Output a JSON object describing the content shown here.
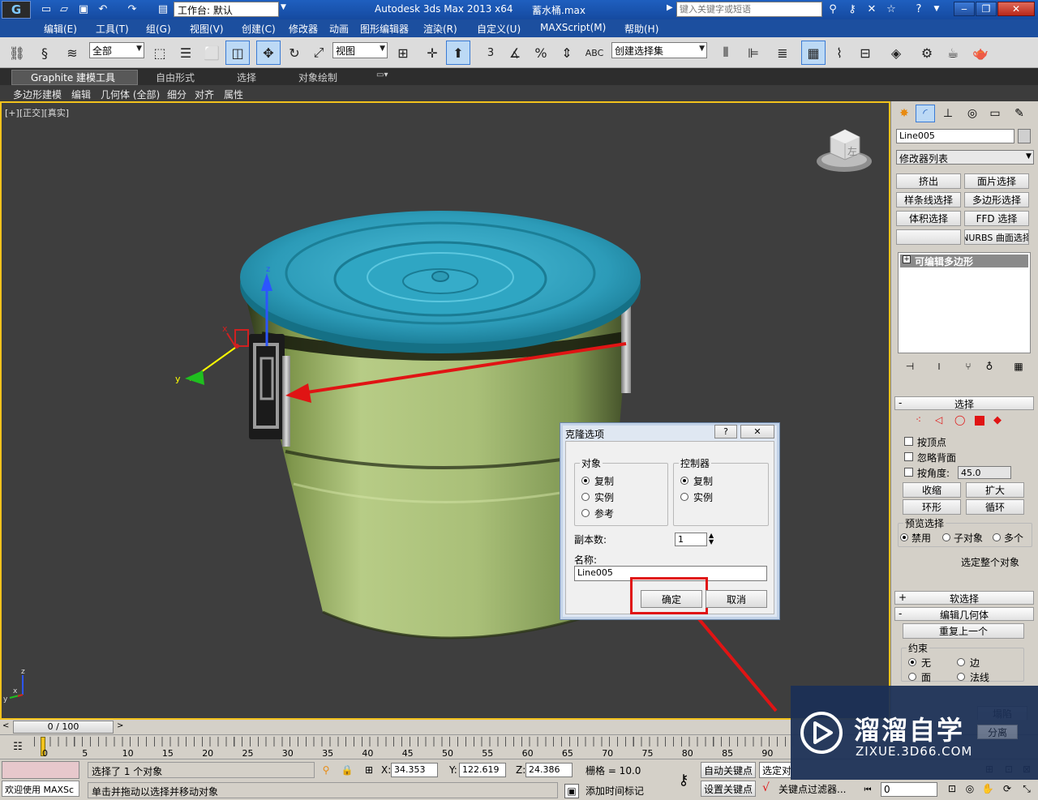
{
  "titlebar": {
    "workspace_label": "工作台: 默认",
    "app_title": "Autodesk 3ds Max  2013 x64",
    "file_name": "蓄水桶.max",
    "search_placeholder": "键入关键字或短语"
  },
  "menubar": {
    "items": [
      "编辑(E)",
      "工具(T)",
      "组(G)",
      "视图(V)",
      "创建(C)",
      "修改器",
      "动画",
      "图形编辑器",
      "渲染(R)",
      "自定义(U)",
      "MAXScript(M)",
      "帮助(H)"
    ]
  },
  "toolbar": {
    "selection_filter": "全部",
    "ref_coord": "视图",
    "named_selection": "创建选择集",
    "snap_label": "3",
    "percent_label": "%"
  },
  "ribbon": {
    "tabs": [
      "Graphite 建模工具",
      "自由形式",
      "选择",
      "对象绘制"
    ],
    "subtabs": [
      "多边形建模",
      "编辑",
      "几何体 (全部)",
      "细分",
      "对齐",
      "属性"
    ]
  },
  "viewport": {
    "label_plus": "[+]",
    "label_view": "[正交]",
    "label_shading": "[真实]",
    "viewcube_text": "左",
    "gizmo_axes": [
      "z",
      "y",
      "x"
    ],
    "corner_axes": [
      "z",
      "x",
      "y"
    ]
  },
  "command_panel": {
    "object_name": "Line005",
    "modifier_list": "修改器列表",
    "modifier_buttons": [
      "挤出",
      "面片选择",
      "样条线选择",
      "多边形选择",
      "体积选择",
      "FFD 选择",
      "",
      "NURBS 曲面选择"
    ],
    "stack_item": "可编辑多边形",
    "selection_rollout": {
      "title": "选择",
      "by_vertex": "按顶点",
      "ignore_backfacing": "忽略背面",
      "by_angle": "按角度:",
      "angle_value": "45.0",
      "shrink": "收缩",
      "grow": "扩大",
      "ring": "环形",
      "loop": "循环",
      "preview_title": "预览选择",
      "preview_disable": "禁用",
      "preview_subobject": "子对象",
      "preview_multi": "多个",
      "select_whole": "选定整个对象"
    },
    "soft_selection": "软选择",
    "edit_geometry": "编辑几何体",
    "repeat_last": "重复上一个",
    "constraints": {
      "title": "约束",
      "none": "无",
      "edge": "边",
      "face": "面",
      "normal": "法线"
    },
    "partial_buttons": [
      "塌陷",
      "分离"
    ]
  },
  "dialog": {
    "title": "克隆选项",
    "help_button": "?",
    "close_button": "✕",
    "object_group": "对象",
    "object_options": [
      "复制",
      "实例",
      "参考"
    ],
    "object_selected": 0,
    "controller_group": "控制器",
    "controller_options": [
      "复制",
      "实例"
    ],
    "controller_selected": 0,
    "copies_label": "副本数:",
    "copies_value": "1",
    "name_label": "名称:",
    "name_value": "Line005",
    "ok_button": "确定",
    "cancel_button": "取消"
  },
  "timeline": {
    "frame_label": "0 / 100",
    "ticks": [
      "0",
      "5",
      "10",
      "15",
      "20",
      "25",
      "30",
      "35",
      "40",
      "45",
      "50",
      "55",
      "60",
      "65",
      "70",
      "75",
      "80",
      "85",
      "90"
    ]
  },
  "status": {
    "welcome": "欢迎使用 MAXSc",
    "selected": "选择了 1 个对象",
    "prompt": "单击并拖动以选择并移动对象",
    "x_label": "X:",
    "x_value": "34.353",
    "y_label": "Y:",
    "y_value": "122.619",
    "z_label": "Z:",
    "z_value": "24.386",
    "grid": "栅格 = 10.0",
    "add_time_tag": "添加时间标记",
    "auto_key": "自动关键点",
    "set_key": "设置关键点",
    "selected_obj": "选定对",
    "key_filters": "关键点过滤器...",
    "frame_value": "0"
  },
  "watermark": {
    "brand": "溜溜自学",
    "url": "ZIXUE.3D66.COM"
  },
  "colors": {
    "title_blue": "#1f5fbf",
    "viewport_bg": "#3e3e3e",
    "bucket_green": "#a9bf78",
    "lid_cyan": "#35a8c4",
    "annotation_red": "#e01414",
    "viewport_border": "#f2c21c"
  }
}
